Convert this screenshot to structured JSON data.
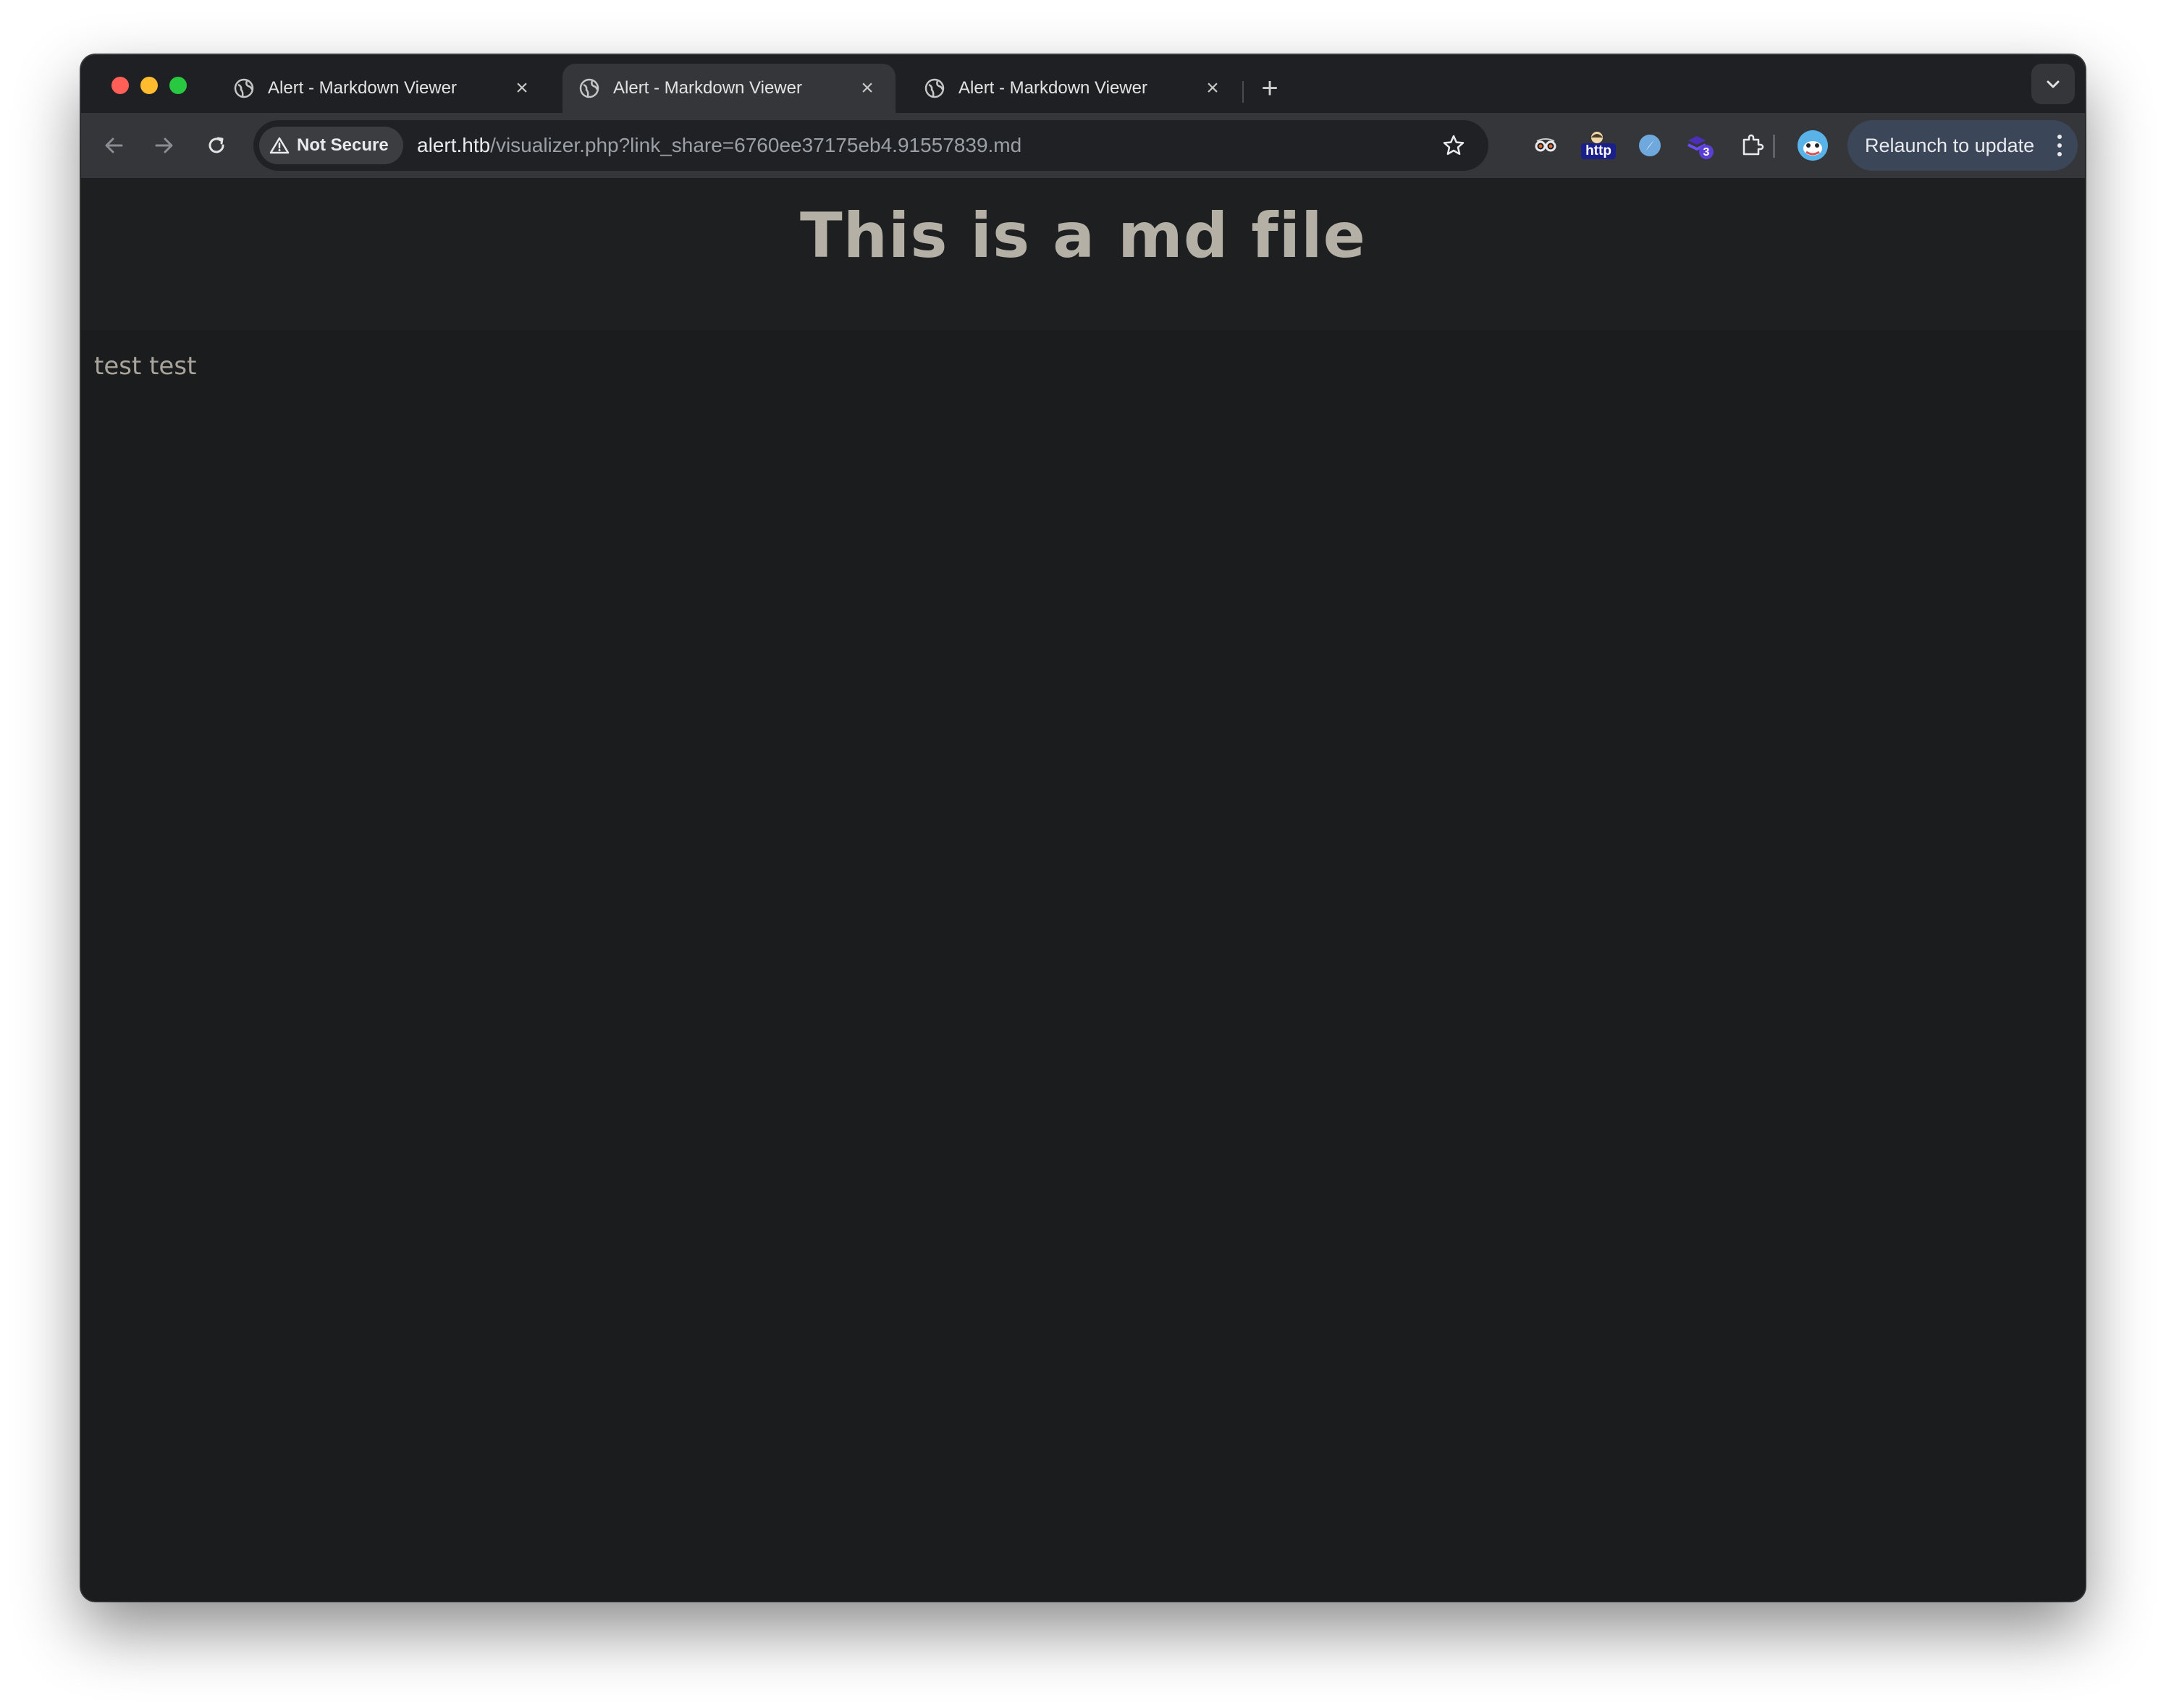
{
  "browser": {
    "tabs": [
      {
        "title": "Alert - Markdown Viewer",
        "active": false
      },
      {
        "title": "Alert - Markdown Viewer",
        "active": true
      },
      {
        "title": "Alert - Markdown Viewer",
        "active": false
      }
    ],
    "tab_close_glyph": "×",
    "new_tab_glyph": "+",
    "security_label": "Not Secure",
    "url_host": "alert.htb",
    "url_path": "/visualizer.php?link_share=6760ee37175eb4.91557839.md",
    "extensions": [
      {
        "icon": "glasses-extension-icon"
      },
      {
        "icon": "http-extension-icon",
        "label": "http"
      },
      {
        "icon": "compass-extension-icon"
      },
      {
        "icon": "wappalyzer-extension-icon",
        "badge": "3"
      },
      {
        "icon": "puzzle-extensions-icon"
      }
    ],
    "relaunch_label": "Relaunch to update",
    "colors": {
      "frame": "#1f2023",
      "toolbar": "#35363a",
      "page_bg": "#1b1c1e",
      "text": "#b5b0a6"
    }
  },
  "page": {
    "title": "This is a md file",
    "body": "test test"
  }
}
